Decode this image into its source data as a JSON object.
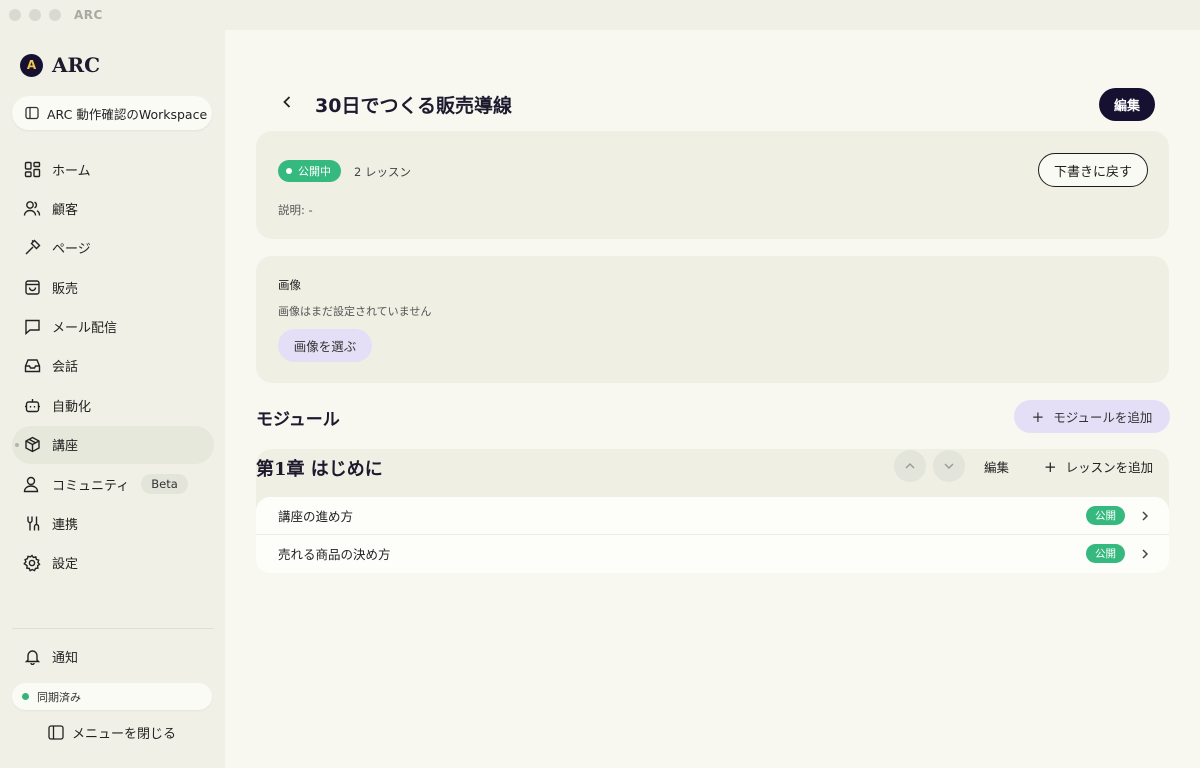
{
  "window": {
    "title": "ARC"
  },
  "sidebar": {
    "brand": "ARC",
    "brand_logo": "A",
    "workspace": "ARC 動作確認のWorkspace",
    "items": [
      {
        "label": "ホーム",
        "icon": "grid-icon"
      },
      {
        "label": "顧客",
        "icon": "users-icon"
      },
      {
        "label": "ページ",
        "icon": "hammer-icon"
      },
      {
        "label": "販売",
        "icon": "shopping-bag-icon"
      },
      {
        "label": "メール配信",
        "icon": "message-square-icon"
      },
      {
        "label": "会話",
        "icon": "inbox-icon"
      },
      {
        "label": "自動化",
        "icon": "bot-icon"
      },
      {
        "label": "講座",
        "icon": "package-icon",
        "active": true
      },
      {
        "label": "コミュニティ",
        "icon": "user-circle-icon",
        "badge": "Beta"
      },
      {
        "label": "連携",
        "icon": "link-icon"
      },
      {
        "label": "設定",
        "icon": "gear-icon"
      }
    ],
    "notify": "通知",
    "sync_status": "同期済み",
    "close_menu": "メニューを閉じる"
  },
  "main": {
    "title": "30日でつくる販売導線",
    "edit": "編集",
    "status_badge": "公開中",
    "lesson_count": "2 レッスン",
    "description": "説明: -",
    "draft_button": "下書きに戻す",
    "image": {
      "heading": "画像",
      "empty": "画像はまだ設定されていません",
      "choose": "画像を選ぶ"
    },
    "modules_heading": "モジュール",
    "add_module": "モジュールを追加",
    "chapter": {
      "title": "第1章 はじめに",
      "edit": "編集",
      "add_lesson": "レッスンを追加",
      "lessons": [
        {
          "title": "講座の進め方",
          "status": "公開"
        },
        {
          "title": "売れる商品の決め方",
          "status": "公開"
        }
      ]
    }
  },
  "colors": {
    "accent_dark": "#161131",
    "published_green": "#35b97f",
    "lavender": "#e5def7",
    "sidebar_bg": "#f0f0e6"
  }
}
